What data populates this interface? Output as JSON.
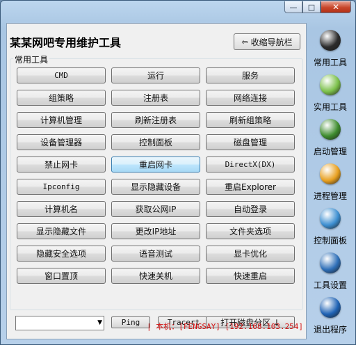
{
  "window": {
    "minimize_glyph": "—",
    "maximize_glyph": "□",
    "close_glyph": "✕"
  },
  "app": {
    "title": "某某网吧专用维护工具",
    "collapse_button": "收缩导航栏",
    "collapse_arrow": "⇦"
  },
  "group": {
    "label": "常用工具",
    "buttons": [
      [
        "CMD",
        "运行",
        "服务"
      ],
      [
        "组策略",
        "注册表",
        "网络连接"
      ],
      [
        "计算机管理",
        "刷新注册表",
        "刷新组策略"
      ],
      [
        "设备管理器",
        "控制面板",
        "磁盘管理"
      ],
      [
        "禁止网卡",
        "重启网卡",
        "DirectX(DX)"
      ],
      [
        "Ipconfig",
        "显示隐藏设备",
        "重启Explorer"
      ],
      [
        "计算机名",
        "获取公网IP",
        "自动登录"
      ],
      [
        "显示隐藏文件",
        "更改IP地址",
        "文件夹选项"
      ],
      [
        "隐藏安全选项",
        "语音测试",
        "显卡优化"
      ],
      [
        "窗口置顶",
        "快速关机",
        "快速重启"
      ]
    ]
  },
  "bottom": {
    "combo_value": "",
    "combo_arrow": "▼",
    "ping": "Ping",
    "tracert": "Tracert",
    "open_partition": "打开磁盘分区 ↓"
  },
  "status": {
    "text": "| 本机：[FENGSAY]  [192.168.103.254]"
  },
  "sidebar": {
    "items": [
      {
        "label": "常用工具",
        "icon": "usage-icon",
        "color": "#2b2b2b"
      },
      {
        "label": "实用工具",
        "icon": "tools-icon",
        "color": "#7cc04a"
      },
      {
        "label": "启动管理",
        "icon": "startup-icon",
        "color": "#3e8c2e"
      },
      {
        "label": "进程管理",
        "icon": "process-icon",
        "color": "#e8a020"
      },
      {
        "label": "控制面板",
        "icon": "control-panel-icon",
        "color": "#3d8fd1"
      },
      {
        "label": "工具设置",
        "icon": "settings-icon",
        "color": "#2e6fb8"
      },
      {
        "label": "退出程序",
        "icon": "exit-icon",
        "color": "#1f63b5"
      }
    ]
  }
}
